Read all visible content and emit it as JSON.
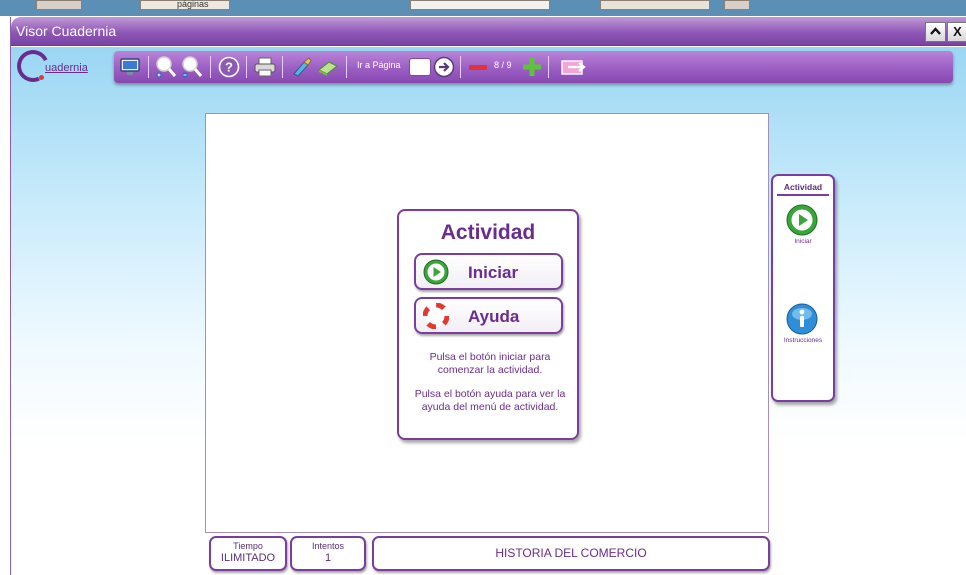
{
  "background": {
    "fragment_text": "páginas"
  },
  "window": {
    "title": "Visor Cuadernia",
    "collapse_icon": "chevron-up-icon",
    "close_label": "X"
  },
  "toolbar": {
    "brand": "uadernia",
    "goto_label": "Ir a Página",
    "goto_value": "",
    "page_counter": "8 / 9",
    "icons": [
      "monitor-icon",
      "zoom-in-icon",
      "zoom-out-icon",
      "help-icon",
      "printer-icon",
      "brush-icon",
      "eraser-icon",
      "arrow-right-circle-icon",
      "minus-icon",
      "plus-icon",
      "exit-icon"
    ]
  },
  "activity": {
    "heading": "Actividad",
    "start_label": "Iniciar",
    "help_label": "Ayuda",
    "instructions_start": "Pulsa el botón iniciar para comenzar la actividad.",
    "instructions_help": "Pulsa el botón ayuda para ver la ayuda del menú de actividad."
  },
  "side_panel": {
    "title": "Actividad",
    "start_label": "Iniciar",
    "instructions_label": "Instrucciones"
  },
  "status": {
    "time_label": "Tiempo",
    "time_value": "ILIMITADO",
    "attempts_label": "Intentos",
    "attempts_value": "1",
    "title": "HISTORIA DEL COMERCIO"
  },
  "colors": {
    "accent": "#7b3ea0",
    "titlebar": "#8e57b6",
    "sky": "#9ad6f3",
    "play_green": "#3aa53a",
    "info_blue": "#2f8ed8"
  }
}
